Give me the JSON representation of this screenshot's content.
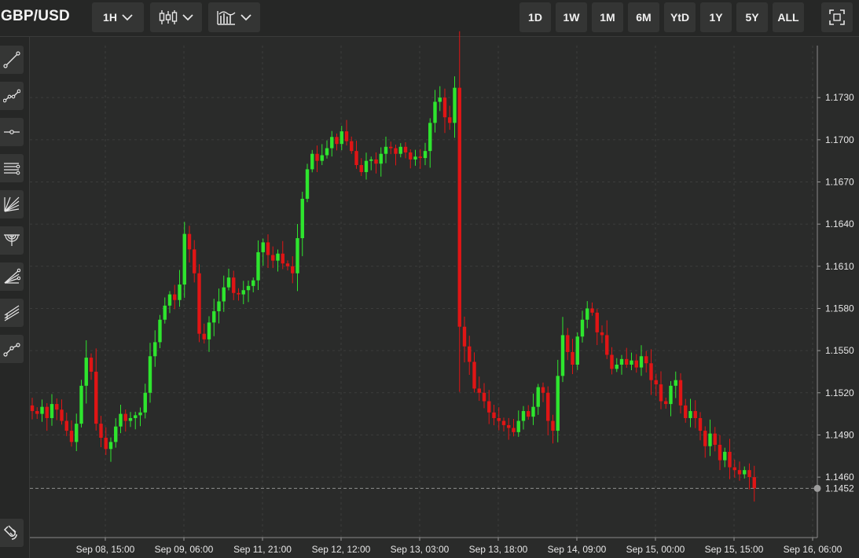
{
  "header": {
    "symbol": "GBP/USD",
    "interval": "1H",
    "ranges": [
      "1D",
      "1W",
      "1M",
      "6M",
      "YtD",
      "1Y",
      "5Y",
      "ALL"
    ]
  },
  "sidebar": {
    "tools": [
      {
        "name": "trend-line-tool",
        "icon": "trend-line-icon"
      },
      {
        "name": "multi-point-line-tool",
        "icon": "polyline-icon"
      },
      {
        "name": "horizontal-line-tool",
        "icon": "horizontal-line-icon"
      },
      {
        "name": "parallel-channel-tool",
        "icon": "parallel-lines-icon"
      },
      {
        "name": "fan-lines-tool",
        "icon": "fan-lines-icon"
      },
      {
        "name": "fibonacci-arcs-tool",
        "icon": "arcs-icon"
      },
      {
        "name": "fibonacci-fan-tool",
        "icon": "fib-fan-icon"
      },
      {
        "name": "pitchfork-tool",
        "icon": "pitchfork-icon"
      },
      {
        "name": "path-tool",
        "icon": "path-icon"
      }
    ],
    "bottom_tool": {
      "name": "magnet-tool",
      "icon": "magnet-icon"
    }
  },
  "colors": {
    "up": "#2ee52e",
    "down": "#e01515",
    "background": "#2a2b2a",
    "grid": "#3c3d3c",
    "text": "#e6e6e6"
  },
  "chart_data": {
    "type": "candlestick",
    "pair": "GBP/USD",
    "interval": "1H",
    "y_ticks": [
      1.173,
      1.17,
      1.167,
      1.164,
      1.161,
      1.158,
      1.155,
      1.152,
      1.149,
      1.146
    ],
    "ylim": [
      1.1417,
      1.1767
    ],
    "last_price": 1.1452,
    "x_ticks": [
      "Sep 08, 15:00",
      "Sep 09, 06:00",
      "Sep 11, 21:00",
      "Sep 12, 12:00",
      "Sep 13, 03:00",
      "Sep 13, 18:00",
      "Sep 14, 09:00",
      "Sep 15, 00:00",
      "Sep 15, 15:00",
      "Sep 16, 06:00"
    ],
    "grid": true,
    "closes": [
      1.1507,
      1.1505,
      1.151,
      1.1502,
      1.1512,
      1.1508,
      1.15,
      1.1493,
      1.1485,
      1.1498,
      1.1525,
      1.1545,
      1.1535,
      1.1498,
      1.1488,
      1.148,
      1.1485,
      1.1496,
      1.1505,
      1.15,
      1.1502,
      1.1504,
      1.1506,
      1.152,
      1.1546,
      1.1556,
      1.1572,
      1.1582,
      1.159,
      1.1586,
      1.1597,
      1.1633,
      1.1622,
      1.1605,
      1.1562,
      1.1558,
      1.157,
      1.1578,
      1.1585,
      1.1595,
      1.1602,
      1.1591,
      1.159,
      1.1593,
      1.1596,
      1.16,
      1.162,
      1.1627,
      1.1618,
      1.1614,
      1.1619,
      1.1612,
      1.161,
      1.1605,
      1.163,
      1.1658,
      1.1679,
      1.169,
      1.1685,
      1.1689,
      1.1694,
      1.1702,
      1.1697,
      1.1706,
      1.1699,
      1.1692,
      1.1682,
      1.1677,
      1.1685,
      1.1686,
      1.1683,
      1.169,
      1.1695,
      1.1694,
      1.169,
      1.1695,
      1.1691,
      1.1686,
      1.1688,
      1.1687,
      1.1692,
      1.1712,
      1.1727,
      1.173,
      1.1716,
      1.1712,
      1.1737,
      1.1567,
      1.1553,
      1.1542,
      1.1523,
      1.152,
      1.1514,
      1.1506,
      1.1502,
      1.15,
      1.1497,
      1.1495,
      1.1492,
      1.15,
      1.1507,
      1.1503,
      1.151,
      1.1524,
      1.152,
      1.15,
      1.1493,
      1.1532,
      1.1561,
      1.1549,
      1.154,
      1.156,
      1.1572,
      1.158,
      1.1577,
      1.1563,
      1.1561,
      1.1547,
      1.1537,
      1.154,
      1.1544,
      1.154,
      1.1543,
      1.1538,
      1.1546,
      1.1541,
      1.1529,
      1.1526,
      1.1514,
      1.1512,
      1.1525,
      1.1529,
      1.1511,
      1.1502,
      1.1507,
      1.1502,
      1.1493,
      1.1482,
      1.1491,
      1.1483,
      1.1472,
      1.1478,
      1.1467,
      1.1465,
      1.1462,
      1.1465,
      1.146,
      1.1452
    ]
  }
}
